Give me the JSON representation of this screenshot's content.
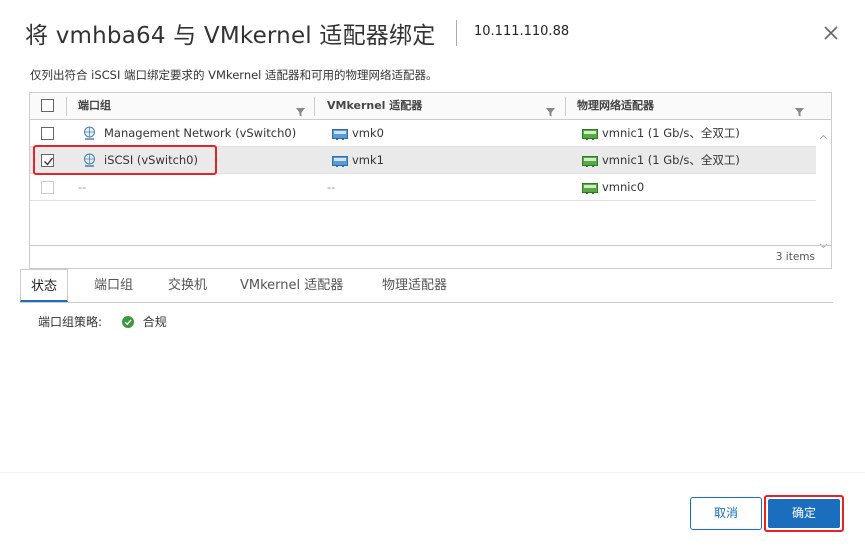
{
  "dialog": {
    "title": "将 vmhba64 与 VMkernel 适配器绑定",
    "host": "10.111.110.88",
    "description": "仅列出符合 iSCSI 端口绑定要求的 VMkernel 适配器和可用的物理网络适配器。"
  },
  "grid": {
    "columns": [
      "端口组",
      "VMkernel 适配器",
      "物理网络适配器"
    ],
    "rows": [
      {
        "checked": false,
        "enabled": true,
        "port_group": "Management Network (vSwitch0)",
        "vmkernel": "vmk0",
        "physical": "vmnic1 (1 Gb/s、全双工)"
      },
      {
        "checked": true,
        "enabled": true,
        "port_group": "iSCSI (vSwitch0)",
        "vmkernel": "vmk1",
        "physical": "vmnic1 (1 Gb/s、全双工)"
      },
      {
        "checked": false,
        "enabled": false,
        "port_group": "--",
        "vmkernel": "--",
        "physical": "vmnic0"
      }
    ],
    "items_count": "3 items"
  },
  "tabs": [
    "状态",
    "端口组",
    "交换机",
    "VMkernel 适配器",
    "物理适配器"
  ],
  "active_tab": "状态",
  "status": {
    "label": "端口组策略:",
    "value": "合规",
    "icon": "check-circle-icon",
    "color": "#3c9a3c"
  },
  "buttons": {
    "cancel": "取消",
    "ok": "确定"
  },
  "colors": {
    "accent": "#1b6dbd",
    "highlight": "#e3222a"
  }
}
